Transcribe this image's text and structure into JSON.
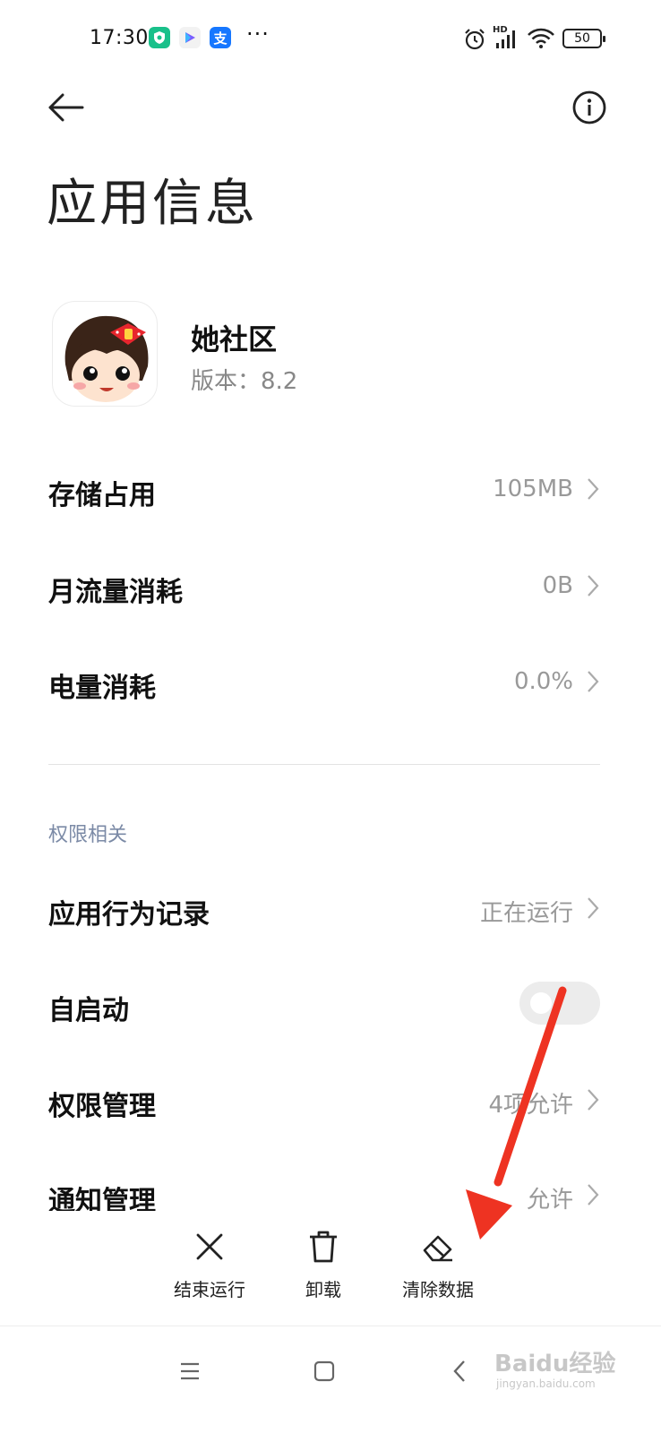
{
  "status_bar": {
    "time": "17:30",
    "app_icons": [
      "security-icon",
      "play-store-icon",
      "alipay-icon"
    ],
    "alipay_glyph": "支",
    "more": "···",
    "network": "HD",
    "battery": "50"
  },
  "header": {
    "title": "应用信息"
  },
  "app": {
    "name": "她社区",
    "version": "版本：8.2"
  },
  "rows": [
    {
      "label": "存储占用",
      "value": "105MB"
    },
    {
      "label": "月流量消耗",
      "value": "0B"
    },
    {
      "label": "电量消耗",
      "value": "0.0%"
    }
  ],
  "permissions_section": {
    "title": "权限相关",
    "rows": [
      {
        "label": "应用行为记录",
        "value": "正在运行"
      },
      {
        "label": "自启动",
        "toggle": false
      },
      {
        "label": "权限管理",
        "value": "4项允许"
      },
      {
        "label": "通知管理",
        "value": "允许"
      }
    ]
  },
  "actions": [
    {
      "label": "结束运行",
      "icon": "close-icon"
    },
    {
      "label": "卸载",
      "icon": "trash-icon"
    },
    {
      "label": "清除数据",
      "icon": "eraser-icon"
    }
  ],
  "nav": [
    "menu-icon",
    "home-icon",
    "back-icon"
  ],
  "annotation": {
    "color": "#ee3322"
  },
  "watermark": {
    "text": "Baidu经验",
    "sub": "jingyan.baidu.com"
  }
}
